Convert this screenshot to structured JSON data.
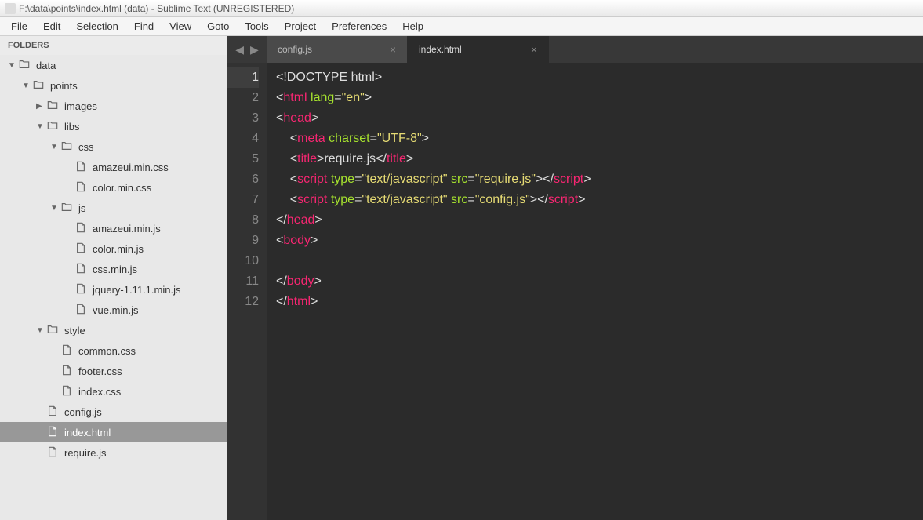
{
  "window": {
    "title": "F:\\data\\points\\index.html (data) - Sublime Text (UNREGISTERED)"
  },
  "menu": {
    "file": "File",
    "edit": "Edit",
    "selection": "Selection",
    "find": "Find",
    "view": "View",
    "goto": "Goto",
    "tools": "Tools",
    "project": "Project",
    "preferences": "Preferences",
    "help": "Help"
  },
  "sidebar": {
    "header": "FOLDERS",
    "items": [
      {
        "label": "data",
        "type": "folder",
        "depth": 0,
        "open": true
      },
      {
        "label": "points",
        "type": "folder",
        "depth": 1,
        "open": true
      },
      {
        "label": "images",
        "type": "folder",
        "depth": 2,
        "open": false
      },
      {
        "label": "libs",
        "type": "folder",
        "depth": 2,
        "open": true
      },
      {
        "label": "css",
        "type": "folder",
        "depth": 3,
        "open": true
      },
      {
        "label": "amazeui.min.css",
        "type": "file",
        "depth": 4
      },
      {
        "label": "color.min.css",
        "type": "file",
        "depth": 4
      },
      {
        "label": "js",
        "type": "folder",
        "depth": 3,
        "open": true
      },
      {
        "label": "amazeui.min.js",
        "type": "file",
        "depth": 4
      },
      {
        "label": "color.min.js",
        "type": "file",
        "depth": 4
      },
      {
        "label": "css.min.js",
        "type": "file",
        "depth": 4
      },
      {
        "label": "jquery-1.11.1.min.js",
        "type": "file",
        "depth": 4
      },
      {
        "label": "vue.min.js",
        "type": "file",
        "depth": 4
      },
      {
        "label": "style",
        "type": "folder",
        "depth": 2,
        "open": true
      },
      {
        "label": "common.css",
        "type": "file",
        "depth": 3
      },
      {
        "label": "footer.css",
        "type": "file",
        "depth": 3
      },
      {
        "label": "index.css",
        "type": "file",
        "depth": 3
      },
      {
        "label": "config.js",
        "type": "file",
        "depth": 2
      },
      {
        "label": "index.html",
        "type": "file",
        "depth": 2,
        "selected": true
      },
      {
        "label": "require.js",
        "type": "file",
        "depth": 2
      }
    ]
  },
  "tabs": [
    {
      "label": "config.js",
      "active": false
    },
    {
      "label": "index.html",
      "active": true
    }
  ],
  "code": {
    "current_line": 1,
    "lines": [
      [
        {
          "t": "<!",
          "c": "punct"
        },
        {
          "t": "DOCTYPE html",
          "c": "doctype"
        },
        {
          "t": ">",
          "c": "punct"
        }
      ],
      [
        {
          "t": "<",
          "c": "punct"
        },
        {
          "t": "html",
          "c": "tag"
        },
        {
          "t": " ",
          "c": "text"
        },
        {
          "t": "lang",
          "c": "attr"
        },
        {
          "t": "=",
          "c": "punct"
        },
        {
          "t": "\"en\"",
          "c": "string"
        },
        {
          "t": ">",
          "c": "punct"
        }
      ],
      [
        {
          "t": "<",
          "c": "punct"
        },
        {
          "t": "head",
          "c": "tag"
        },
        {
          "t": ">",
          "c": "punct"
        }
      ],
      [
        {
          "t": "    <",
          "c": "punct"
        },
        {
          "t": "meta",
          "c": "tag"
        },
        {
          "t": " ",
          "c": "text"
        },
        {
          "t": "charset",
          "c": "attr"
        },
        {
          "t": "=",
          "c": "punct"
        },
        {
          "t": "\"UTF-8\"",
          "c": "string"
        },
        {
          "t": ">",
          "c": "punct"
        }
      ],
      [
        {
          "t": "    <",
          "c": "punct"
        },
        {
          "t": "title",
          "c": "tag"
        },
        {
          "t": ">",
          "c": "punct"
        },
        {
          "t": "require.js",
          "c": "text"
        },
        {
          "t": "</",
          "c": "punct"
        },
        {
          "t": "title",
          "c": "tag"
        },
        {
          "t": ">",
          "c": "punct"
        }
      ],
      [
        {
          "t": "    <",
          "c": "punct"
        },
        {
          "t": "script",
          "c": "tag"
        },
        {
          "t": " ",
          "c": "text"
        },
        {
          "t": "type",
          "c": "attr"
        },
        {
          "t": "=",
          "c": "punct"
        },
        {
          "t": "\"text/javascript\"",
          "c": "string"
        },
        {
          "t": " ",
          "c": "text"
        },
        {
          "t": "src",
          "c": "attr"
        },
        {
          "t": "=",
          "c": "punct"
        },
        {
          "t": "\"require.js\"",
          "c": "string"
        },
        {
          "t": ">",
          "c": "punct"
        },
        {
          "t": "</",
          "c": "punct"
        },
        {
          "t": "script",
          "c": "tag"
        },
        {
          "t": ">",
          "c": "punct"
        }
      ],
      [
        {
          "t": "    <",
          "c": "punct"
        },
        {
          "t": "script",
          "c": "tag"
        },
        {
          "t": " ",
          "c": "text"
        },
        {
          "t": "type",
          "c": "attr"
        },
        {
          "t": "=",
          "c": "punct"
        },
        {
          "t": "\"text/javascript\"",
          "c": "string"
        },
        {
          "t": " ",
          "c": "text"
        },
        {
          "t": "src",
          "c": "attr"
        },
        {
          "t": "=",
          "c": "punct"
        },
        {
          "t": "\"config.js\"",
          "c": "string"
        },
        {
          "t": ">",
          "c": "punct"
        },
        {
          "t": "</",
          "c": "punct"
        },
        {
          "t": "script",
          "c": "tag"
        },
        {
          "t": ">",
          "c": "punct"
        }
      ],
      [
        {
          "t": "</",
          "c": "punct"
        },
        {
          "t": "head",
          "c": "tag"
        },
        {
          "t": ">",
          "c": "punct"
        }
      ],
      [
        {
          "t": "<",
          "c": "punct"
        },
        {
          "t": "body",
          "c": "tag"
        },
        {
          "t": ">",
          "c": "punct"
        }
      ],
      [],
      [
        {
          "t": "</",
          "c": "punct"
        },
        {
          "t": "body",
          "c": "tag"
        },
        {
          "t": ">",
          "c": "punct"
        }
      ],
      [
        {
          "t": "</",
          "c": "punct"
        },
        {
          "t": "html",
          "c": "tag"
        },
        {
          "t": ">",
          "c": "punct"
        }
      ]
    ]
  }
}
